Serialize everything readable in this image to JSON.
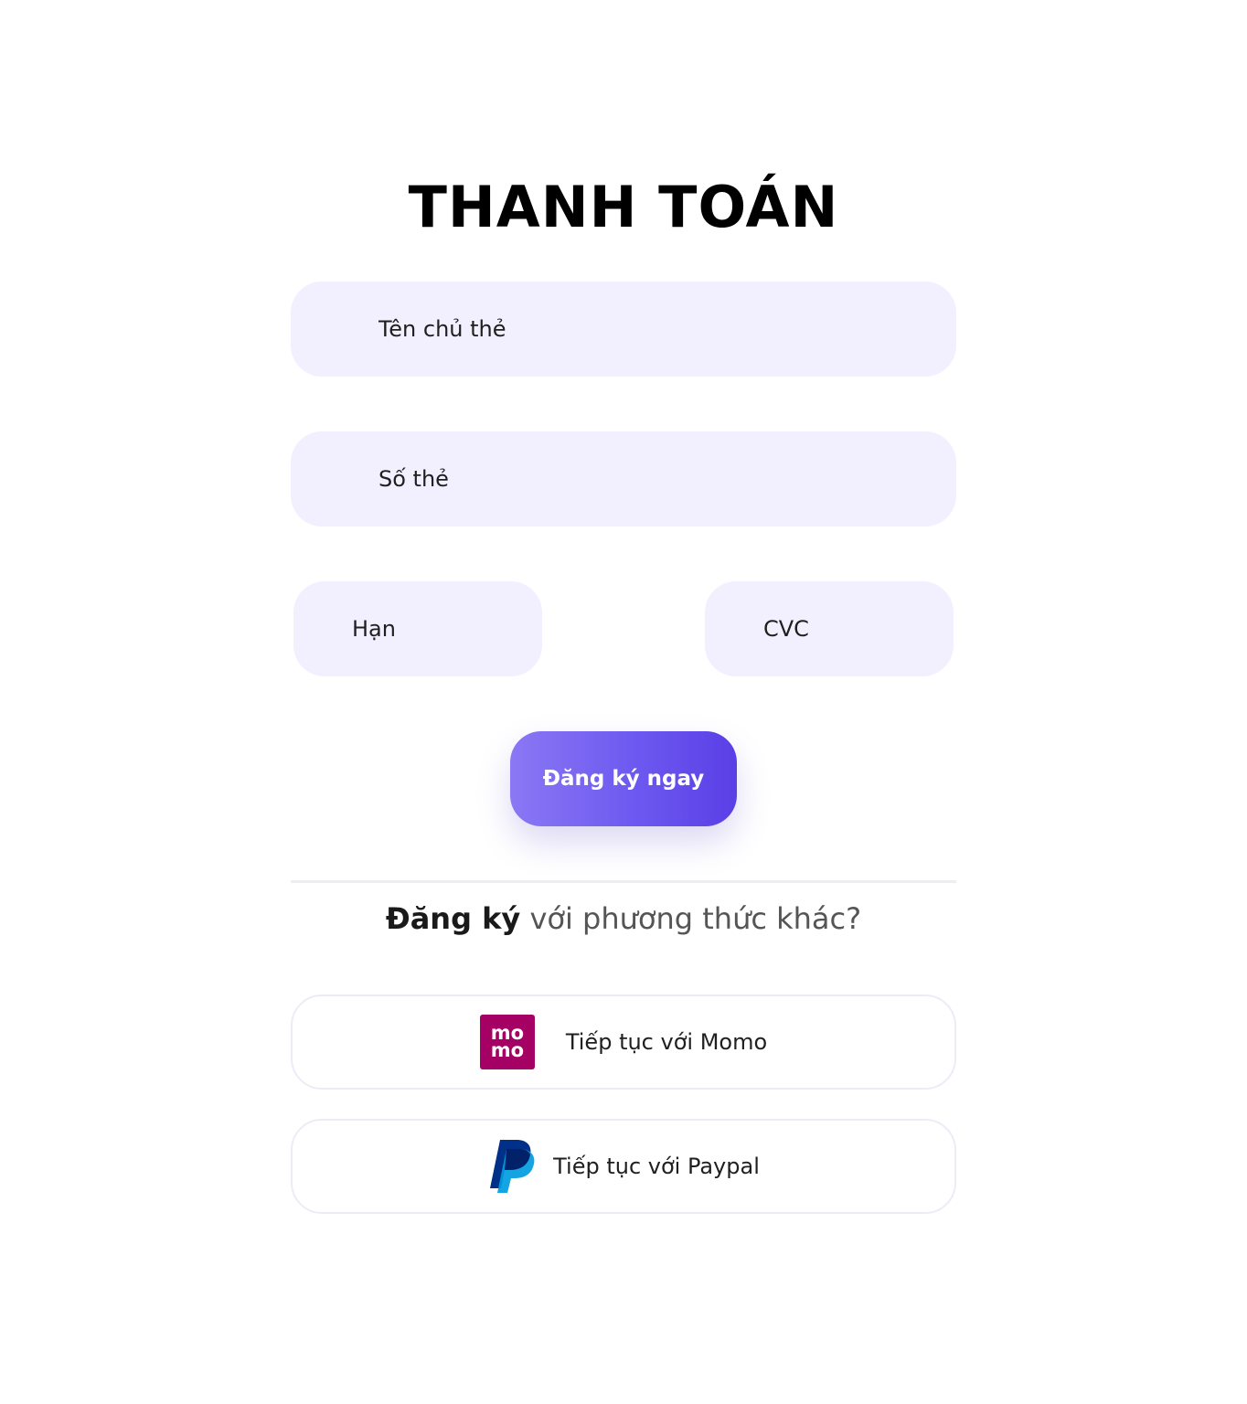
{
  "page": {
    "title": "THANH TOÁN"
  },
  "form": {
    "cardholder_placeholder": "Tên chủ thẻ",
    "card_number_placeholder": "Số thẻ",
    "expiry_placeholder": "Hạn",
    "cvc_placeholder": "CVC",
    "submit_label": "Đăng ký ngay"
  },
  "alternatives": {
    "heading_strong": "Đăng ký",
    "heading_rest": " với phương thức khác?",
    "momo": {
      "logo_line1": "mo",
      "logo_line2": "mo",
      "label": "Tiếp tục với Momo",
      "brand_color": "#a50064"
    },
    "paypal": {
      "label": "Tiếp tục với Paypal",
      "brand_color_dark": "#003087",
      "brand_color_light": "#009cde"
    }
  },
  "colors": {
    "field_background": "#f2f0fe",
    "accent_start": "#8a78f4",
    "accent_end": "#5a3fe6"
  }
}
